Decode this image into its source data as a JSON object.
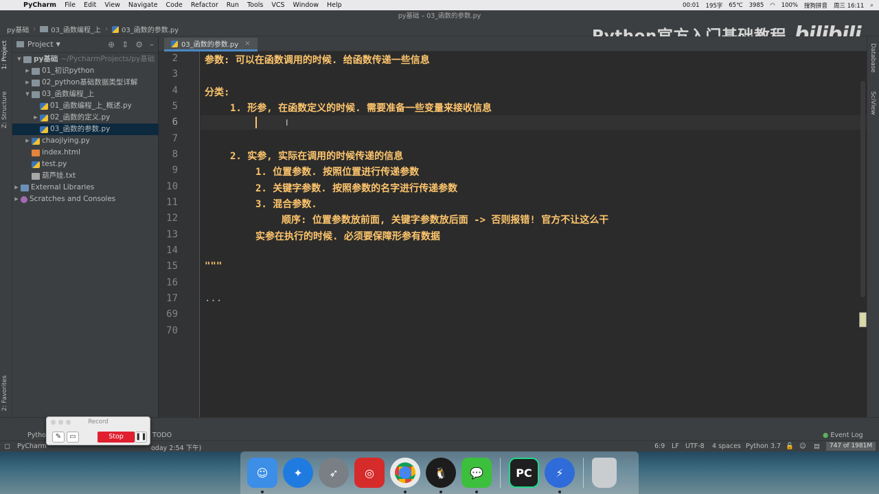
{
  "menubar": {
    "app_name": "PyCharm",
    "items": [
      "File",
      "Edit",
      "View",
      "Navigate",
      "Code",
      "Refactor",
      "Run",
      "Tools",
      "VCS",
      "Window",
      "Help"
    ],
    "status": {
      "timer": "00:01",
      "battery_label": "195字",
      "temp": "65℃",
      "fan": "3985",
      "battery_pct": "100%",
      "input_method": "搜狗拼音",
      "clock": "周三 16:11"
    }
  },
  "window_title": "py基础 – 03_函数的参数.py",
  "breadcrumb": [
    "py基础",
    "03_函数编程_上",
    "03_函数的参数.py"
  ],
  "watermark": {
    "text": "Python官方入门基础教程",
    "logo": "bilibili"
  },
  "left_strip": {
    "project_tab": "1: Project",
    "structure_tab": "Z: Structure",
    "favorites_tab": "2: Favorites"
  },
  "right_strip": {
    "database_tab": "Database",
    "sciview_tab": "SciView"
  },
  "project_panel": {
    "title": "Project",
    "tree": [
      {
        "label": "py基础",
        "path": "~/PycharmProjects/py基础"
      },
      {
        "label": "01_初识python"
      },
      {
        "label": "02_python基础数据类型详解"
      },
      {
        "label": "03_函数编程_上"
      },
      {
        "label": "01_函数编程_上_概述.py"
      },
      {
        "label": "02_函数的定义.py"
      },
      {
        "label": "03_函数的参数.py"
      },
      {
        "label": "chaojiying.py"
      },
      {
        "label": "index.html"
      },
      {
        "label": "test.py"
      },
      {
        "label": "葫芦娃.txt"
      },
      {
        "label": "External Libraries"
      },
      {
        "label": "Scratches and Consoles"
      }
    ]
  },
  "editor": {
    "tab_label": "03_函数的参数.py",
    "lines": [
      {
        "num": "2",
        "text": "参数: 可以在函数调用的时候. 给函数传递一些信息"
      },
      {
        "num": "3",
        "text": ""
      },
      {
        "num": "4",
        "text": "分类:"
      },
      {
        "num": "5",
        "text": "1. 形参, 在函数定义的时候. 需要准备一些变量来接收信息"
      },
      {
        "num": "6",
        "text": ""
      },
      {
        "num": "7",
        "text": ""
      },
      {
        "num": "8",
        "text": "2. 实参, 实际在调用的时候传递的信息"
      },
      {
        "num": "9",
        "text": "1. 位置参数. 按照位置进行传递参数"
      },
      {
        "num": "10",
        "text": "2. 关键字参数. 按照参数的名字进行传递参数"
      },
      {
        "num": "11",
        "text": "3. 混合参数."
      },
      {
        "num": "12",
        "text": "顺序: 位置参数放前面, 关键字参数放后面 -> 否则报错! 官方不让这么干"
      },
      {
        "num": "13",
        "text": "实参在执行的时候. 必须要保障形参有数据"
      },
      {
        "num": "14",
        "text": ""
      },
      {
        "num": "15",
        "text": "\"\"\""
      },
      {
        "num": "16",
        "text": ""
      },
      {
        "num": "17",
        "text": "..."
      },
      {
        "num": "69",
        "text": ""
      },
      {
        "num": "70",
        "text": ""
      }
    ]
  },
  "bottom_tools": {
    "python_console": "Pytho",
    "todo": "TODO",
    "event_log": "Event Log"
  },
  "statusbar": {
    "message": "PyCharm",
    "message_tail": "oday 2:54 下午)",
    "position": "6:9",
    "line_sep": "LF",
    "encoding": "UTF-8",
    "indent": "4 spaces",
    "interpreter": "Python 3.7",
    "memory": "747 of 1981M"
  },
  "record_widget": {
    "title": "Record",
    "stop_label": "Stop"
  },
  "dock": {
    "apps": [
      {
        "name": "Finder",
        "color": "#3c8ee6"
      },
      {
        "name": "Safari",
        "color": "#1f7be0"
      },
      {
        "name": "Launchpad",
        "color": "#7a7f86"
      },
      {
        "name": "NetEase Music",
        "color": "#d62b2b"
      },
      {
        "name": "Chrome",
        "color": "#e9e9e9"
      },
      {
        "name": "QQ",
        "color": "#1c1c1c"
      },
      {
        "name": "WeChat",
        "color": "#3cbf3c"
      },
      {
        "name": "PyCharm",
        "color": "#1f1f1f"
      },
      {
        "name": "Thunder",
        "color": "#2f6bd9"
      },
      {
        "name": "Trash",
        "color": "#c9cdd0"
      }
    ],
    "pycharm_label": "PC"
  },
  "colors": {
    "code_text": "#ffc66d",
    "selected_row": "#0d293e",
    "tab_underline": "#4a88c7",
    "stop_button": "#e0202e"
  }
}
